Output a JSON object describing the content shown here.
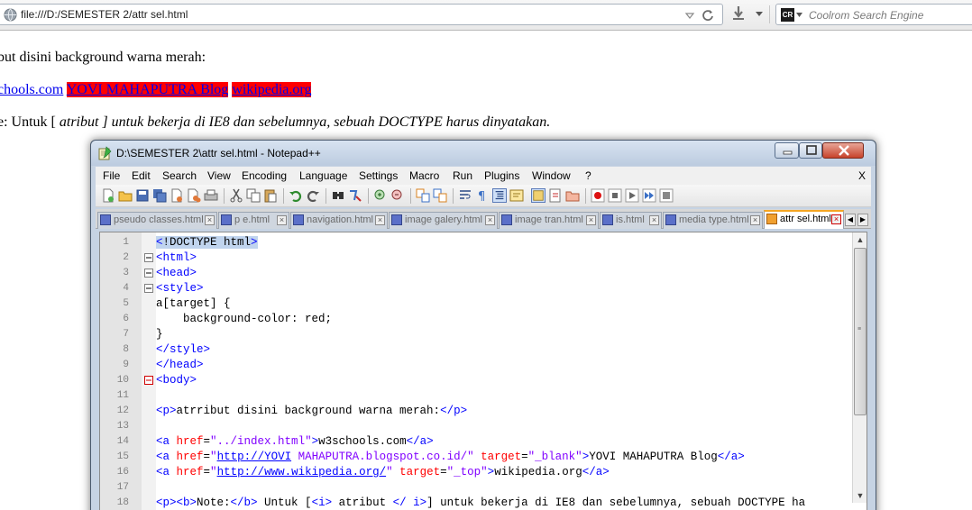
{
  "browser": {
    "url": "file:///D:/SEMESTER 2/attr sel.html",
    "search_placeholder": "Coolrom Search Engine",
    "search_engine_label": "CR"
  },
  "page": {
    "line1": "but disini background warna merah:",
    "links": [
      {
        "label": "chools.com",
        "red": false
      },
      {
        "label": "YOVI MAHAPUTRA Blog",
        "red": true
      },
      {
        "label": "wikipedia.org",
        "red": true
      }
    ],
    "note_prefix": "e: Untuk [ ",
    "note_italic": "atribut ] untuk bekerja di IE8 dan sebelumnya, sebuah DOCTYPE harus dinyatakan."
  },
  "npp": {
    "title": "D:\\SEMESTER 2\\attr sel.html - Notepad++",
    "menu": [
      "File",
      "Edit",
      "Search",
      "View",
      "Encoding",
      "Language",
      "Settings",
      "Macro",
      "Run",
      "Plugins",
      "Window",
      "?"
    ],
    "menu_close": "X",
    "tabs": [
      {
        "label": "pseudo classes.html",
        "active": false
      },
      {
        "label": "p e.html",
        "active": false
      },
      {
        "label": "navigation.html",
        "active": false
      },
      {
        "label": "image galery.html",
        "active": false
      },
      {
        "label": "image tran.html",
        "active": false
      },
      {
        "label": "is.html",
        "active": false
      },
      {
        "label": "media type.html",
        "active": false
      },
      {
        "label": "attr sel.html",
        "active": true
      }
    ],
    "line_numbers": [
      "1",
      "2",
      "3",
      "4",
      "5",
      "6",
      "7",
      "8",
      "9",
      "10",
      "11",
      "12",
      "13",
      "14",
      "15",
      "16",
      "17",
      "18"
    ]
  },
  "colors": {
    "tag": "#0000ff",
    "attr": "#ff0000",
    "value": "#8000ff",
    "link": "#0000ee",
    "red_bg": "#ff0000"
  }
}
